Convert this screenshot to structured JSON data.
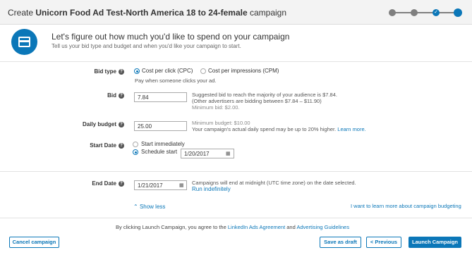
{
  "header": {
    "title_prefix": "Create",
    "campaign_name": "Unicorn Food Ad Test-North America 18 to 24-female",
    "title_suffix": "campaign",
    "progress_steps": 4,
    "current_step": 4,
    "checkmark": "✓"
  },
  "intro": {
    "icon": "credit-card-icon",
    "heading": "Let's figure out how much you'd like to spend on your campaign",
    "subheading": "Tell us your bid type and budget and when you'd like your campaign to start."
  },
  "bid_type": {
    "label": "Bid type",
    "options": [
      {
        "label": "Cost per click (CPC)",
        "selected": true
      },
      {
        "label": "Cost per impressions (CPM)",
        "selected": false
      }
    ],
    "hint": "Pay when someone clicks your ad."
  },
  "bid": {
    "label": "Bid",
    "value": "7.84",
    "suggestion_line1": "Suggested bid to reach the majority of your audience is $7.84.",
    "suggestion_line2": "(Other advertisers are bidding between $7.84 – $11.90)",
    "minimum": "Minimum bid: $2.00."
  },
  "daily_budget": {
    "label": "Daily budget",
    "value": "25.00",
    "minimum": "Minimum budget: $10.00",
    "note": "Your campaign's actual daily spend may be up to 20% higher.",
    "learn_more": "Learn more."
  },
  "start_date": {
    "label": "Start Date",
    "options": [
      {
        "label": "Start immediately",
        "selected": false
      },
      {
        "label": "Schedule start",
        "selected": true
      }
    ],
    "value": "1/20/2017"
  },
  "end_date": {
    "label": "End Date",
    "value": "1/21/2017",
    "note": "Campaigns will end at midnight (UTC time zone) on the date selected.",
    "run_indefinitely": "Run indefinitely"
  },
  "links": {
    "show_less": "Show less",
    "learn_budgeting": "I want to learn more about campaign budgeting"
  },
  "agreement": {
    "prefix": "By clicking Launch Campaign, you agree to the",
    "ads_agreement": "LinkedIn Ads Agreement",
    "and": "and",
    "guidelines": "Advertising Guidelines"
  },
  "buttons": {
    "cancel": "Cancel campaign",
    "save_draft": "Save as draft",
    "previous": "< Previous",
    "launch": "Launch Campaign"
  },
  "colors": {
    "accent": "#0b77b8",
    "header_bg": "#f3f3f3",
    "inactive_step": "#7f7f7f"
  }
}
